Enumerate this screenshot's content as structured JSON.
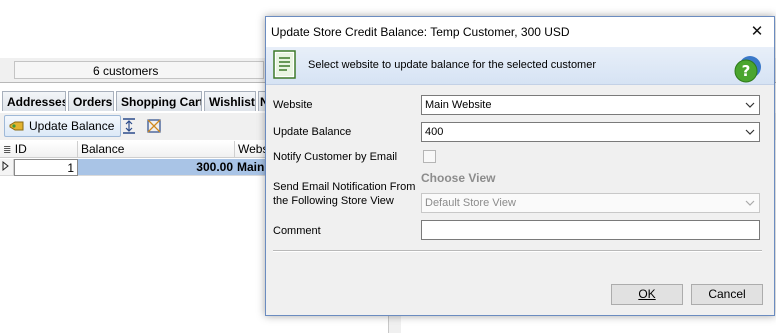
{
  "background": {
    "status": {
      "customers_count": "6 customers"
    },
    "tabs": [
      {
        "label": "Addresses"
      },
      {
        "label": "Orders"
      },
      {
        "label": "Shopping Cart"
      },
      {
        "label": "Wishlist"
      },
      {
        "label": "N"
      }
    ],
    "toolbar": {
      "update_balance_label": "Update Balance"
    },
    "grid": {
      "columns": [
        "ID",
        "Balance",
        "Websi"
      ],
      "rows": [
        {
          "id": "1",
          "balance": "300.00",
          "website": "Main"
        }
      ]
    }
  },
  "dialog": {
    "title": "Update Store Credit Balance: Temp Customer, 300 USD",
    "header_text": "Select website to update balance for the selected customer",
    "fields": {
      "website_label": "Website",
      "website_value": "Main Website",
      "balance_label": "Update Balance",
      "balance_value": "400",
      "notify_label": "Notify Customer by Email",
      "notify_checked": false,
      "store_view_label_line1": "Send Email Notification From",
      "store_view_label_line2": "the Following Store View",
      "choose_view_hint": "Choose View",
      "store_view_value": "Default Store View",
      "comment_label": "Comment",
      "comment_value": ""
    },
    "buttons": {
      "ok": "OK",
      "cancel": "Cancel"
    }
  },
  "colors": {
    "accent": "#6b8cc0",
    "header_band": "#dde8f6",
    "selected_row": "#a9c4e6"
  }
}
